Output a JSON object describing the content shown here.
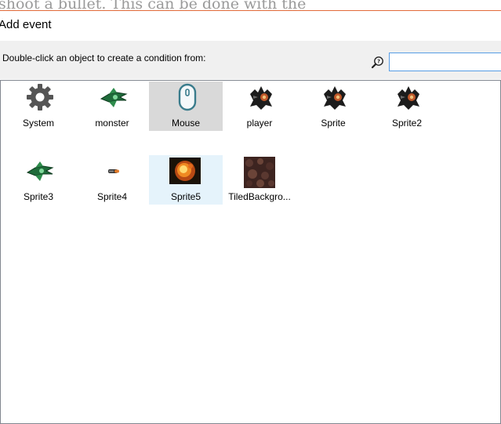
{
  "background_text": "shoot a bullet. This can be done with the",
  "dialog": {
    "title": "Add event",
    "prompt": "Double-click an object to create a condition from:",
    "search": {
      "value": "",
      "placeholder": ""
    }
  },
  "objects": [
    {
      "label": "System",
      "icon": "gear-icon",
      "state": "normal"
    },
    {
      "label": "monster",
      "icon": "green-ship-icon",
      "state": "normal"
    },
    {
      "label": "Mouse",
      "icon": "mouse-icon",
      "state": "selected"
    },
    {
      "label": "player",
      "icon": "dark-ship-icon",
      "state": "normal"
    },
    {
      "label": "Sprite",
      "icon": "dark-ship-icon",
      "state": "normal"
    },
    {
      "label": "Sprite2",
      "icon": "dark-ship-icon",
      "state": "normal"
    },
    {
      "label": "Sprite3",
      "icon": "green-ship-icon",
      "state": "normal"
    },
    {
      "label": "Sprite4",
      "icon": "bullet-icon",
      "state": "normal"
    },
    {
      "label": "Sprite5",
      "icon": "explosion-icon",
      "state": "hover"
    },
    {
      "label": "TiledBackgro...",
      "icon": "rock-texture-icon",
      "state": "normal"
    }
  ],
  "colors": {
    "selected_bg": "#d9d9d9",
    "hover_bg": "#e5f3fb",
    "input_border": "#569de5",
    "title_accent": "#e26b3a"
  }
}
